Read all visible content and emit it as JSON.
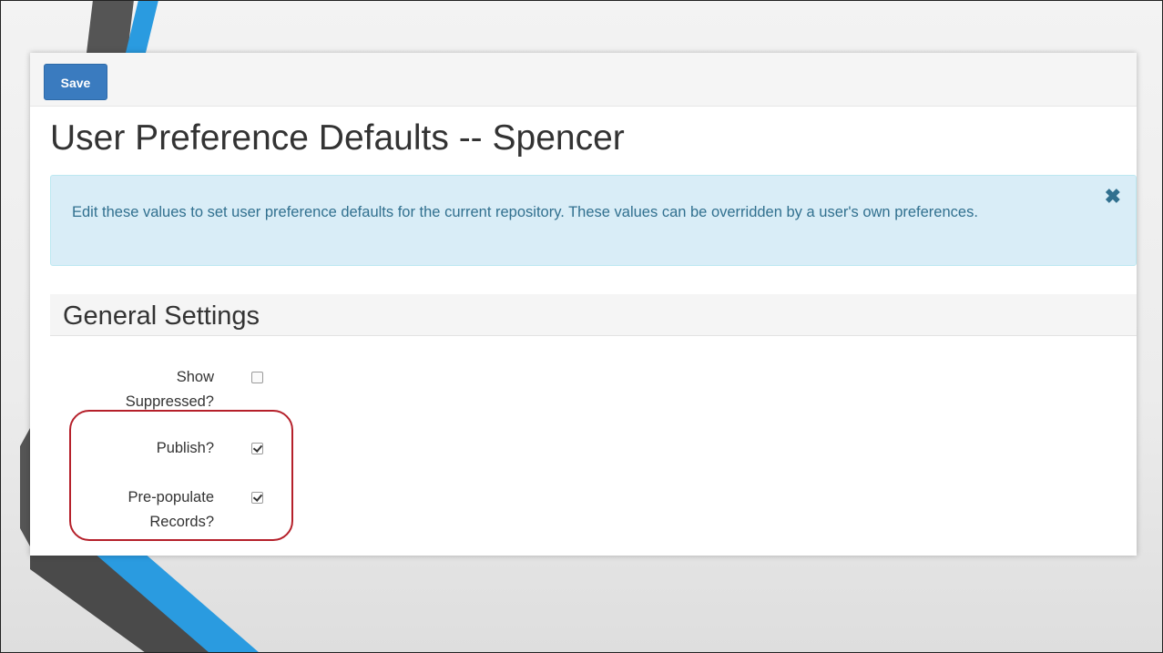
{
  "toolbar": {
    "save_label": "Save"
  },
  "page": {
    "title": "User Preference Defaults -- Spencer"
  },
  "alert": {
    "text": "Edit these values to set user preference defaults for the current repository. These values can be overridden by a user's own preferences.",
    "close_glyph": "✖"
  },
  "section": {
    "title": "General Settings"
  },
  "fields": [
    {
      "label_line1": "Show",
      "label_line2": "Suppressed?",
      "checked": false
    },
    {
      "label_line1": "Publish?",
      "label_line2": "",
      "checked": true
    },
    {
      "label_line1": "Pre-populate",
      "label_line2": "Records?",
      "checked": true
    }
  ],
  "colors": {
    "primary": "#3a7bbf",
    "alert_bg": "#d9edf7",
    "alert_text": "#31708f",
    "highlight": "#b5202a"
  }
}
